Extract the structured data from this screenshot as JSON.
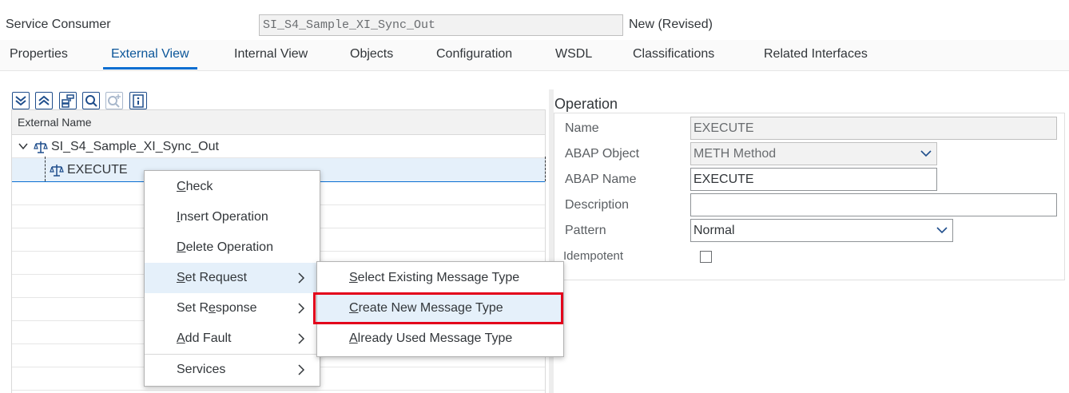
{
  "header": {
    "label": "Service Consumer",
    "name_value": "SI_S4_Sample_XI_Sync_Out",
    "status": "New (Revised)"
  },
  "tabs": [
    {
      "label": "Properties"
    },
    {
      "label": "External View",
      "active": true
    },
    {
      "label": "Internal View"
    },
    {
      "label": "Objects"
    },
    {
      "label": "Configuration"
    },
    {
      "label": "WSDL"
    },
    {
      "label": "Classifications"
    },
    {
      "label": "Related Interfaces"
    }
  ],
  "toolbar": {
    "icons": [
      "expand-all-icon",
      "collapse-all-icon",
      "hierarchy-icon",
      "search-icon",
      "search-next-icon",
      "info-icon"
    ]
  },
  "tree": {
    "column_header": "External Name",
    "root_label": "SI_S4_Sample_XI_Sync_Out",
    "child_label": "EXECUTE"
  },
  "operation": {
    "title": "Operation",
    "name_label": "Name",
    "name_value": "EXECUTE",
    "abap_object_label": "ABAP Object",
    "abap_object_value": "METH Method",
    "abap_name_label": "ABAP Name",
    "abap_name_value": "EXECUTE",
    "description_label": "Description",
    "description_value": "",
    "pattern_label": "Pattern",
    "pattern_value": "Normal",
    "idempotent_label": "Idempotent",
    "idempotent_checked": false
  },
  "context_menu": {
    "check": {
      "mnemonic": "C",
      "rest": "heck"
    },
    "insert": {
      "mnemonic": "I",
      "rest": "nsert Operation"
    },
    "delete": {
      "mnemonic": "D",
      "rest": "elete Operation"
    },
    "set_request": {
      "mnemonic": "S",
      "rest": "et Request"
    },
    "set_response": {
      "pre": "Set R",
      "mnemonic": "e",
      "rest": "sponse"
    },
    "add_fault": {
      "mnemonic": "A",
      "rest": "dd Fault"
    },
    "services": {
      "label": "Services"
    }
  },
  "submenu": {
    "select_existing": {
      "mnemonic": "S",
      "rest": "elect Existing Message Type"
    },
    "create_new": {
      "mnemonic": "C",
      "rest": "reate New Message Type"
    },
    "already_used": {
      "mnemonic": "A",
      "rest": "lready Used Message Type"
    }
  },
  "colors": {
    "accent": "#0a6ed1",
    "highlight_box": "#e3001b",
    "hover": "#e5f0fa"
  }
}
